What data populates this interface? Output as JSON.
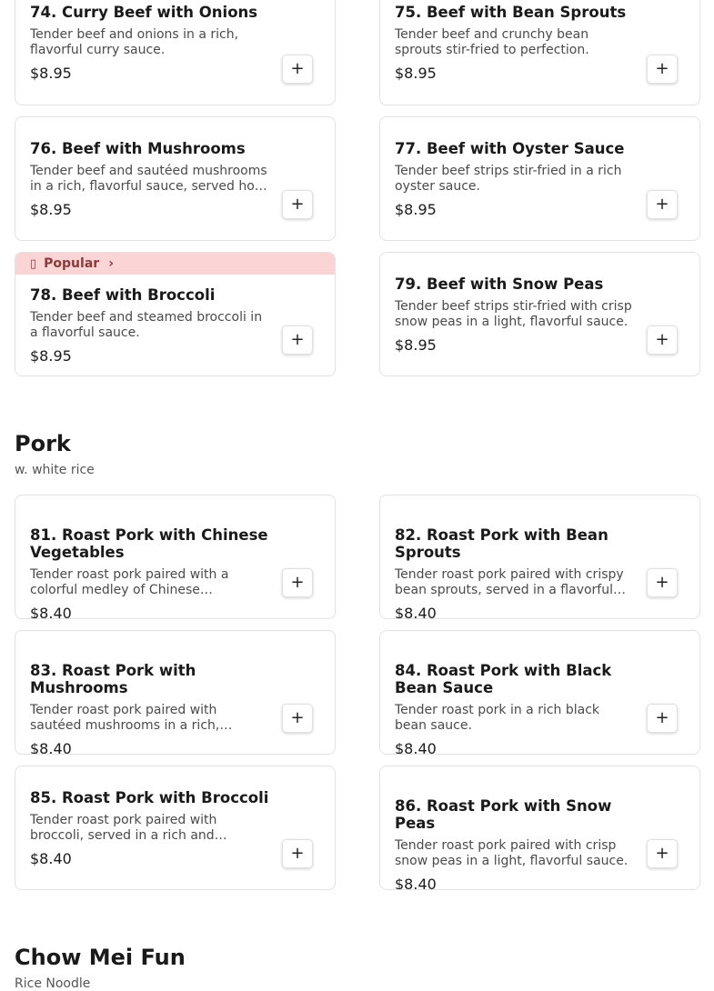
{
  "beef_items": [
    {
      "title": "74. Curry Beef with Onions",
      "desc": "Tender beef and onions in a rich, flavorful curry sauce.",
      "price": "$8.95",
      "add": "+"
    },
    {
      "title": "75. Beef with Bean Sprouts",
      "desc": "Tender beef and crunchy bean sprouts stir-fried to perfection.",
      "price": "$8.95",
      "add": "+"
    },
    {
      "title": "76. Beef with Mushrooms",
      "desc": "Tender beef and sautéed mushrooms in a rich, flavorful sauce, served ho…",
      "price": "$8.95",
      "add": "+"
    },
    {
      "title": "77. Beef with Oyster Sauce",
      "desc": "Tender beef strips stir-fried in a rich oyster sauce.",
      "price": "$8.95",
      "add": "+"
    },
    {
      "title": "78. Beef with Broccoli",
      "desc": "Tender beef and steamed broccoli in a flavorful sauce.",
      "price": "$8.95",
      "add": "+",
      "badge": "Popular",
      "badge_icon": "▯",
      "badge_chevron": "›"
    },
    {
      "title": "79. Beef with Snow Peas",
      "desc": "Tender beef strips stir-fried with crisp snow peas in a light, flavorful sauce.",
      "price": "$8.95",
      "add": "+"
    }
  ],
  "pork_section": {
    "title": "Pork",
    "subtitle": "w. white rice"
  },
  "pork_items": [
    {
      "title": "81. Roast Pork with Chinese Vegetables",
      "desc": "Tender roast pork paired with a colorful medley of Chinese…",
      "price": "$8.40",
      "add": "+"
    },
    {
      "title": "82. Roast Pork with Bean Sprouts",
      "desc": "Tender roast pork paired with crispy bean sprouts, served in a flavorful…",
      "price": "$8.40",
      "add": "+"
    },
    {
      "title": "83. Roast Pork with Mushrooms",
      "desc": "Tender roast pork paired with sautéed mushrooms in a rich,…",
      "price": "$8.40",
      "add": "+"
    },
    {
      "title": "84. Roast Pork with Black Bean Sauce",
      "desc": "Tender roast pork in a rich black bean sauce.",
      "price": "$8.40",
      "add": "+"
    },
    {
      "title": "85. Roast Pork with Broccoli",
      "desc": "Tender roast pork paired with broccoli, served in a rich and…",
      "price": "$8.40",
      "add": "+"
    },
    {
      "title": "86. Roast Pork with Snow Peas",
      "desc": "Tender roast pork paired with crisp snow peas in a light, flavorful sauce.",
      "price": "$8.40",
      "add": "+"
    }
  ],
  "chow_mei_fun_section": {
    "title": "Chow Mei Fun",
    "subtitle": "Rice Noodle"
  }
}
